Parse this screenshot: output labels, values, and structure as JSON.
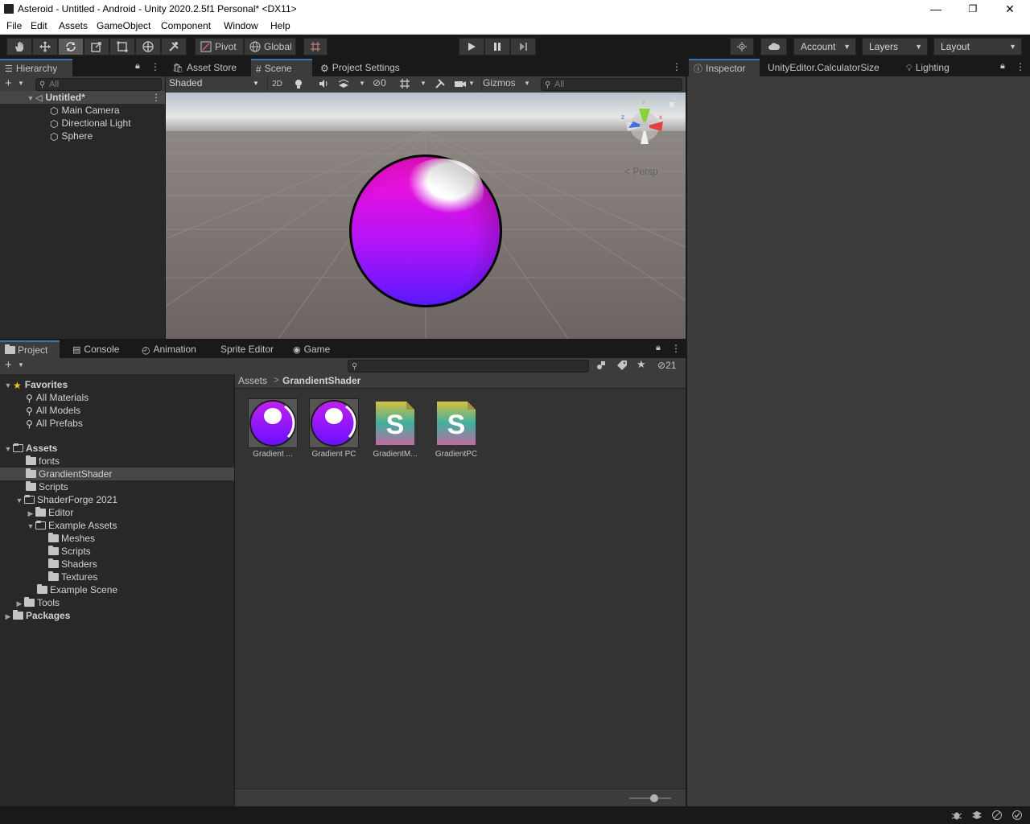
{
  "window": {
    "title": "Asteroid - Untitled - Android - Unity 2020.2.5f1 Personal* <DX11>",
    "controls": {
      "minimize": "—",
      "restore": "❐",
      "close": "✕"
    }
  },
  "menu": [
    "File",
    "Edit",
    "Assets",
    "GameObject",
    "Component",
    "Window",
    "Help"
  ],
  "toolbar": {
    "pivot_label": "Pivot",
    "global_label": "Global",
    "account_label": "Account",
    "layers_label": "Layers",
    "layout_label": "Layout"
  },
  "hierarchy": {
    "tab_label": "Hierarchy",
    "search_placeholder": "All",
    "scene_name": "Untitled*",
    "items": [
      "Main Camera",
      "Directional Light",
      "Sphere"
    ]
  },
  "scene_tabs": {
    "asset_store": "Asset Store",
    "scene": "Scene",
    "project_settings": "Project Settings"
  },
  "scene_toolbar": {
    "shading_mode": "Shaded",
    "mode_2d": "2D",
    "hidden_count": "0",
    "gizmos_label": "Gizmos",
    "search_placeholder": "All"
  },
  "scene_view": {
    "projection_label": "Persp",
    "axis_x": "x",
    "axis_y": "y",
    "axis_z": "z"
  },
  "inspector_tabs": {
    "inspector": "Inspector",
    "calculator": "UnityEditor.CalculatorSize",
    "lighting": "Lighting"
  },
  "bottom_tabs": {
    "project": "Project",
    "console": "Console",
    "animation": "Animation",
    "sprite_editor": "Sprite Editor",
    "game": "Game"
  },
  "project": {
    "hidden_count": "21",
    "favorites_label": "Favorites",
    "favorites": [
      "All Materials",
      "All Models",
      "All Prefabs"
    ],
    "assets_label": "Assets",
    "tree": [
      {
        "label": "fonts",
        "depth": 1
      },
      {
        "label": "GrandientShader",
        "depth": 1,
        "selected": true
      },
      {
        "label": "Scripts",
        "depth": 1
      },
      {
        "label": "ShaderForge 2021",
        "depth": 1,
        "expanded": true
      },
      {
        "label": "Editor",
        "depth": 2,
        "collapsed": true
      },
      {
        "label": "Example Assets",
        "depth": 2,
        "expanded": true
      },
      {
        "label": "Meshes",
        "depth": 3
      },
      {
        "label": "Scripts",
        "depth": 3
      },
      {
        "label": "Shaders",
        "depth": 3
      },
      {
        "label": "Textures",
        "depth": 3
      },
      {
        "label": "Example Scene",
        "depth": 2
      },
      {
        "label": "Tools",
        "depth": 1,
        "collapsed": true
      }
    ],
    "packages_label": "Packages",
    "breadcrumb_root": "Assets",
    "breadcrumb_sep": ">",
    "breadcrumb_current": "GrandientShader",
    "assets_grid": [
      {
        "label": "Gradient ...",
        "kind": "material"
      },
      {
        "label": "Gradient PC",
        "kind": "material"
      },
      {
        "label": "GradientM...",
        "kind": "shader"
      },
      {
        "label": "GradientPC",
        "kind": "shader"
      }
    ],
    "shader_glyph": "S"
  },
  "colors": {
    "accent_tab": "#3a72b0",
    "selection": "#464646",
    "sphere_top": "#ff00d8",
    "sphere_bottom": "#5a10ff"
  }
}
